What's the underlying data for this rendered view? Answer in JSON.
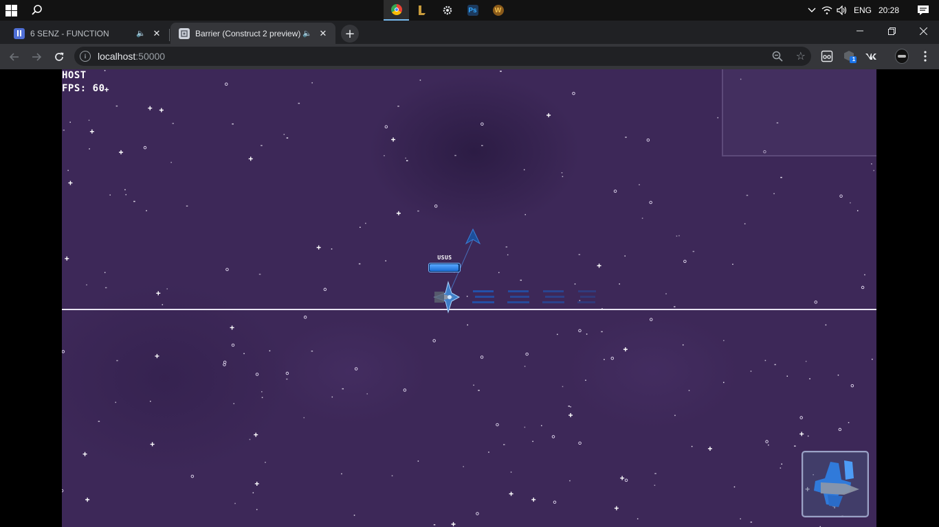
{
  "taskbar": {
    "language": "ENG",
    "clock": "20:28",
    "apps": [
      {
        "icon": "chrome-icon",
        "label": "",
        "active": true,
        "color": "#4285f4"
      },
      {
        "icon": "league-icon",
        "label": "",
        "active": false,
        "color": "#c89b3c"
      },
      {
        "icon": "settings-icon",
        "label": "",
        "active": false,
        "color": "#9aa0a6"
      },
      {
        "icon": "photoshop-icon",
        "label": "Ps",
        "active": false,
        "color": "#1c3a5e"
      },
      {
        "icon": "warcraft-icon",
        "label": "W",
        "active": false,
        "color": "#8a5a1a"
      }
    ]
  },
  "browser": {
    "tabs": [
      {
        "title": "6 SENZ - FUNCTION",
        "active": false,
        "favicon": "music-player-icon",
        "favicon_color": "#4f6fd6"
      },
      {
        "title": "Barrier (Construct 2 preview)",
        "active": true,
        "favicon": "construct-icon",
        "favicon_color": "#cfd3dc"
      }
    ],
    "url_host": "localhost",
    "url_port": ":50000",
    "extension_badge": "1"
  },
  "game": {
    "hud": {
      "role": "HOST",
      "fps": "FPS: 60"
    },
    "player": {
      "name": "USUS",
      "health_fraction": 0.98
    },
    "colors": {
      "background": "#3d2858",
      "barrier": "#e8e4f2",
      "accent": "#1b6fd6"
    }
  }
}
